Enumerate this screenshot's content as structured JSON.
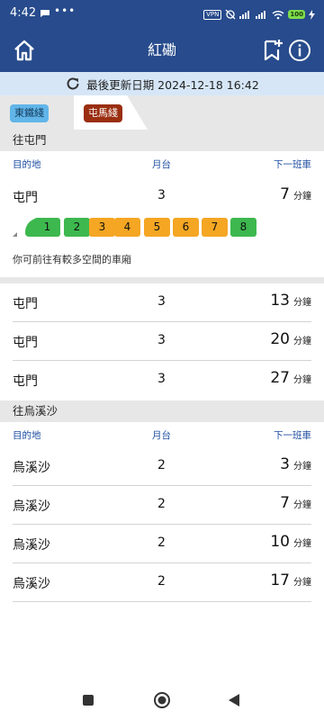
{
  "status_bar": {
    "time": "4:42",
    "more": "•••",
    "vpn": "VPN",
    "battery": "100"
  },
  "header": {
    "title": "紅磡"
  },
  "update": {
    "label": "最後更新日期 2024-12-18 16:42"
  },
  "lines": {
    "east_rail": "東鐵綫",
    "tuen_ma": "屯馬綫"
  },
  "columns": {
    "destination": "目的地",
    "platform": "月台",
    "next": "下一班車"
  },
  "minute_unit": "分鐘",
  "section_tuen_mun": {
    "title": "往屯門",
    "rows": [
      {
        "dest": "屯門",
        "platform": "3",
        "minutes": "7"
      },
      {
        "dest": "屯門",
        "platform": "3",
        "minutes": "13"
      },
      {
        "dest": "屯門",
        "platform": "3",
        "minutes": "20"
      },
      {
        "dest": "屯門",
        "platform": "3",
        "minutes": "27"
      }
    ],
    "cars": [
      "1",
      "2",
      "3",
      "4",
      "5",
      "6",
      "7",
      "8"
    ],
    "car_note": "你可前往有較多空間的車廂"
  },
  "section_wu_kai_sha": {
    "title": "往烏溪沙",
    "rows": [
      {
        "dest": "烏溪沙",
        "platform": "2",
        "minutes": "3"
      },
      {
        "dest": "烏溪沙",
        "platform": "2",
        "minutes": "7"
      },
      {
        "dest": "烏溪沙",
        "platform": "2",
        "minutes": "10"
      },
      {
        "dest": "烏溪沙",
        "platform": "2",
        "minutes": "17"
      }
    ]
  },
  "colors": {
    "header_bg": "#274b8c",
    "update_bg": "#d6e6f7",
    "car_green": "#3db84e",
    "car_orange": "#f5a623",
    "east_rail": "#61b5e8",
    "tuen_ma": "#9a2e10"
  }
}
